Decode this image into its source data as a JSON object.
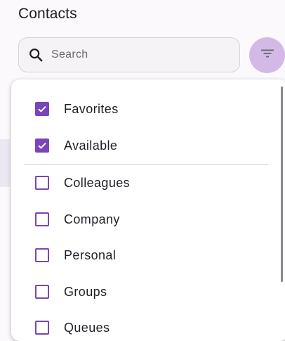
{
  "header": {
    "title": "Contacts"
  },
  "search": {
    "placeholder": "Search",
    "icon": "search-icon"
  },
  "filter_button": {
    "icon": "filter-list-icon",
    "color": "#d3bae6",
    "state": "open"
  },
  "filter_menu": {
    "accent_color": "#7b44b8",
    "items": [
      {
        "label": "Favorites",
        "checked": true
      },
      {
        "label": "Available",
        "checked": true
      },
      {
        "label": "Colleagues",
        "checked": false
      },
      {
        "label": "Company",
        "checked": false
      },
      {
        "label": "Personal",
        "checked": false
      },
      {
        "label": "Groups",
        "checked": false
      },
      {
        "label": "Queues",
        "checked": false
      }
    ]
  }
}
